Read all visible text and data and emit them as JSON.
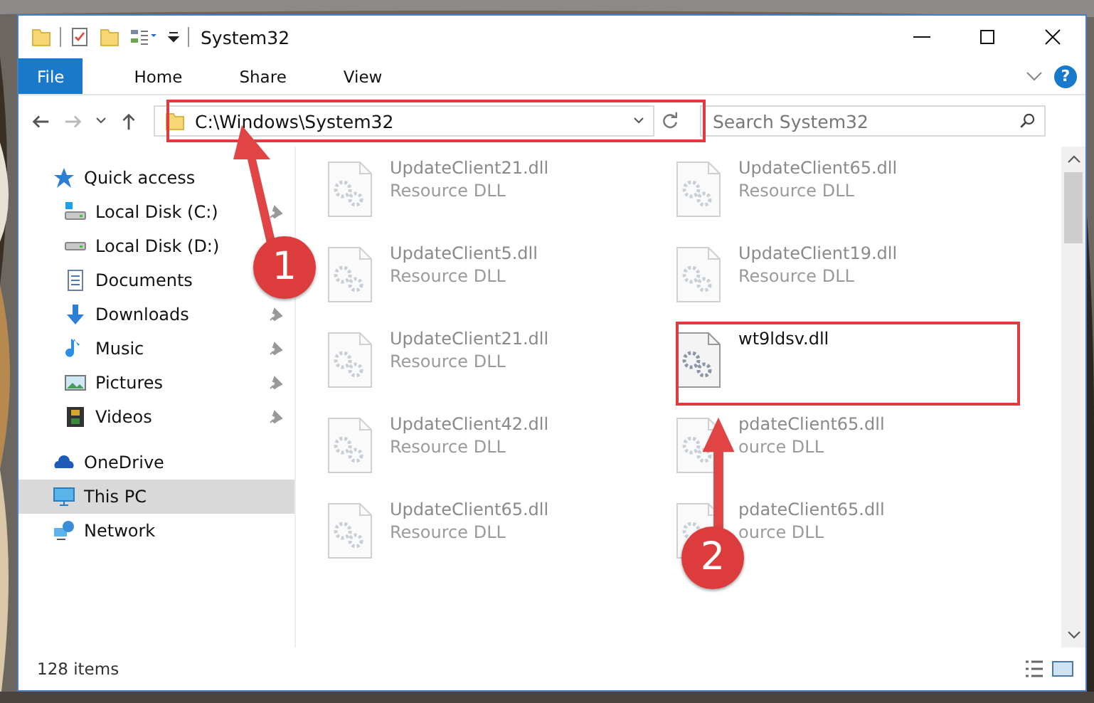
{
  "window": {
    "title": "System32"
  },
  "ribbon_tabs": [
    {
      "label": "File",
      "selected": true
    },
    {
      "label": "Home",
      "selected": false
    },
    {
      "label": "Share",
      "selected": false
    },
    {
      "label": "View",
      "selected": false
    }
  ],
  "help_button": "?",
  "address": {
    "value": "C:\\Windows\\System32"
  },
  "search": {
    "placeholder": "Search System32"
  },
  "sidebar": [
    {
      "label": "Quick access",
      "kind": "star",
      "selected": false,
      "children": [
        {
          "label": "Local Disk (C:)",
          "kind": "drive-c",
          "pinned": true,
          "selected": false
        },
        {
          "label": "Local Disk (D:)",
          "kind": "drive",
          "selected": false
        },
        {
          "label": "Documents",
          "kind": "documents",
          "selected": false
        },
        {
          "label": "Downloads",
          "kind": "downloads",
          "pinned": true,
          "selected": false
        },
        {
          "label": "Music",
          "kind": "music",
          "pinned": true,
          "selected": false
        },
        {
          "label": "Pictures",
          "kind": "pictures",
          "pinned": true,
          "selected": false
        },
        {
          "label": "Videos",
          "kind": "videos",
          "pinned": true,
          "selected": false
        }
      ]
    },
    {
      "label": "OneDrive",
      "kind": "cloud",
      "selected": false
    },
    {
      "label": "This PC",
      "kind": "pc",
      "selected": true
    },
    {
      "label": "Network",
      "kind": "network",
      "selected": false
    }
  ],
  "files": [
    {
      "name": "UpdateClient21.dll",
      "detail": "Resource DLL",
      "blurred": true
    },
    {
      "name": "UpdateClient65.dll",
      "detail": "Resource DLL",
      "blurred": true
    },
    {
      "name": "UpdateClient5.dll",
      "detail": "Resource DLL",
      "blurred": true
    },
    {
      "name": "UpdateClient19.dll",
      "detail": "Resource DLL",
      "blurred": true
    },
    {
      "name": "UpdateClient21.dll",
      "detail": "Resource DLL",
      "blurred": true
    },
    {
      "name": "wt9ldsv.dll",
      "blurred": false
    },
    {
      "name": "UpdateClient42.dll",
      "detail": "Resource DLL",
      "blurred": true
    },
    {
      "name": "pdateClient65.dll",
      "detail": "ource DLL",
      "blurred": true
    },
    {
      "name": "UpdateClient65.dll",
      "detail": "Resource DLL",
      "blurred": true
    },
    {
      "name": "pdateClient65.dll",
      "detail": "ource DLL",
      "blurred": true
    }
  ],
  "status_bar": {
    "item_count": "128 items"
  },
  "callouts": [
    {
      "number": "1"
    },
    {
      "number": "2"
    }
  ]
}
